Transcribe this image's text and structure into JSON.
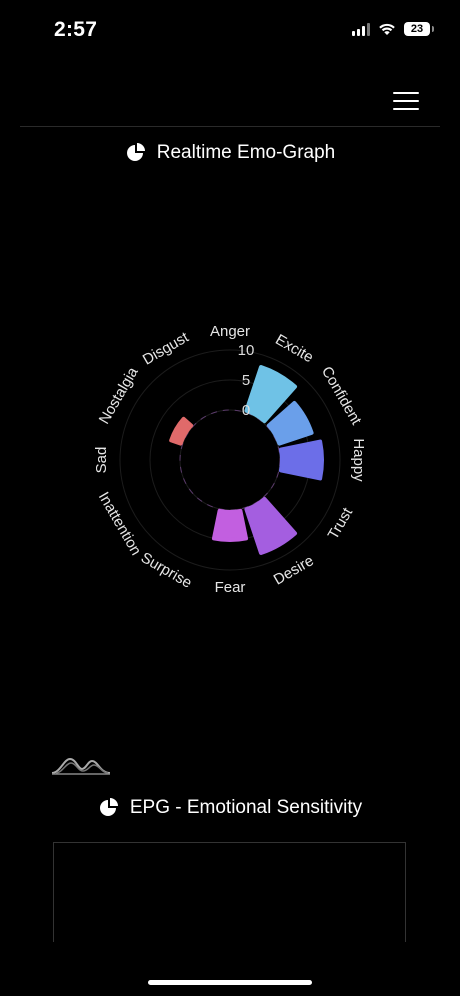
{
  "status_bar": {
    "time": "2:57",
    "battery_level": "23"
  },
  "header": {
    "menu_icon": "hamburger-menu-icon"
  },
  "realtime_section": {
    "title": "Realtime Emo-Graph",
    "icon": "pie-chart-icon"
  },
  "epg_section": {
    "title": "EPG - Emotional Sensitivity",
    "icon": "pie-chart-icon",
    "wave_icon": "waveform-icon"
  },
  "chart_data": {
    "type": "polar-bar",
    "categories": [
      "Excite",
      "Confident",
      "Happy",
      "Trust",
      "Desire",
      "Fear",
      "Surprise",
      "Inattention",
      "Sad",
      "Nostalgia",
      "Disgust",
      "Anger"
    ],
    "values": [
      8,
      6,
      7,
      0,
      8,
      5,
      0,
      0,
      0,
      2,
      0,
      0
    ],
    "radial_ticks": [
      "0",
      "5",
      "10"
    ],
    "rlim": [
      0,
      10
    ],
    "colors": [
      "#6fc2e6",
      "#6a9fea",
      "#6c6ee8",
      "#8b65dc",
      "#a45ee0",
      "#c25fe0",
      "#a06ac8",
      "#b06a9a",
      "#c46c86",
      "#e06a6a",
      "#d86a78",
      "#cc7090"
    ],
    "grid": true
  }
}
